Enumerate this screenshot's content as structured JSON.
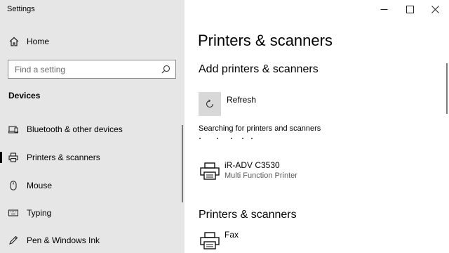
{
  "window": {
    "title": "Settings"
  },
  "sidebar": {
    "home_label": "Home",
    "search_placeholder": "Find a setting",
    "section_title": "Devices",
    "items": [
      {
        "label": "Bluetooth & other devices",
        "icon": "bluetooth-devices-icon"
      },
      {
        "label": "Printers & scanners",
        "icon": "printer-icon",
        "selected": true
      },
      {
        "label": "Mouse",
        "icon": "mouse-icon"
      },
      {
        "label": "Typing",
        "icon": "keyboard-icon"
      },
      {
        "label": "Pen & Windows Ink",
        "icon": "pen-icon"
      }
    ]
  },
  "main": {
    "title": "Printers & scanners",
    "add_heading": "Add printers & scanners",
    "refresh_label": "Refresh",
    "status_text": "Searching for printers and scanners",
    "found_printers": [
      {
        "name": "iR-ADV C3530",
        "type": "Multi Function Printer"
      }
    ],
    "list_heading": "Printers & scanners",
    "installed_printers": [
      {
        "name": "Fax"
      }
    ]
  },
  "colors": {
    "sidebar_bg": "#e6e6e6",
    "main_bg": "#ffffff",
    "refresh_button_bg": "#d8d8d8"
  }
}
